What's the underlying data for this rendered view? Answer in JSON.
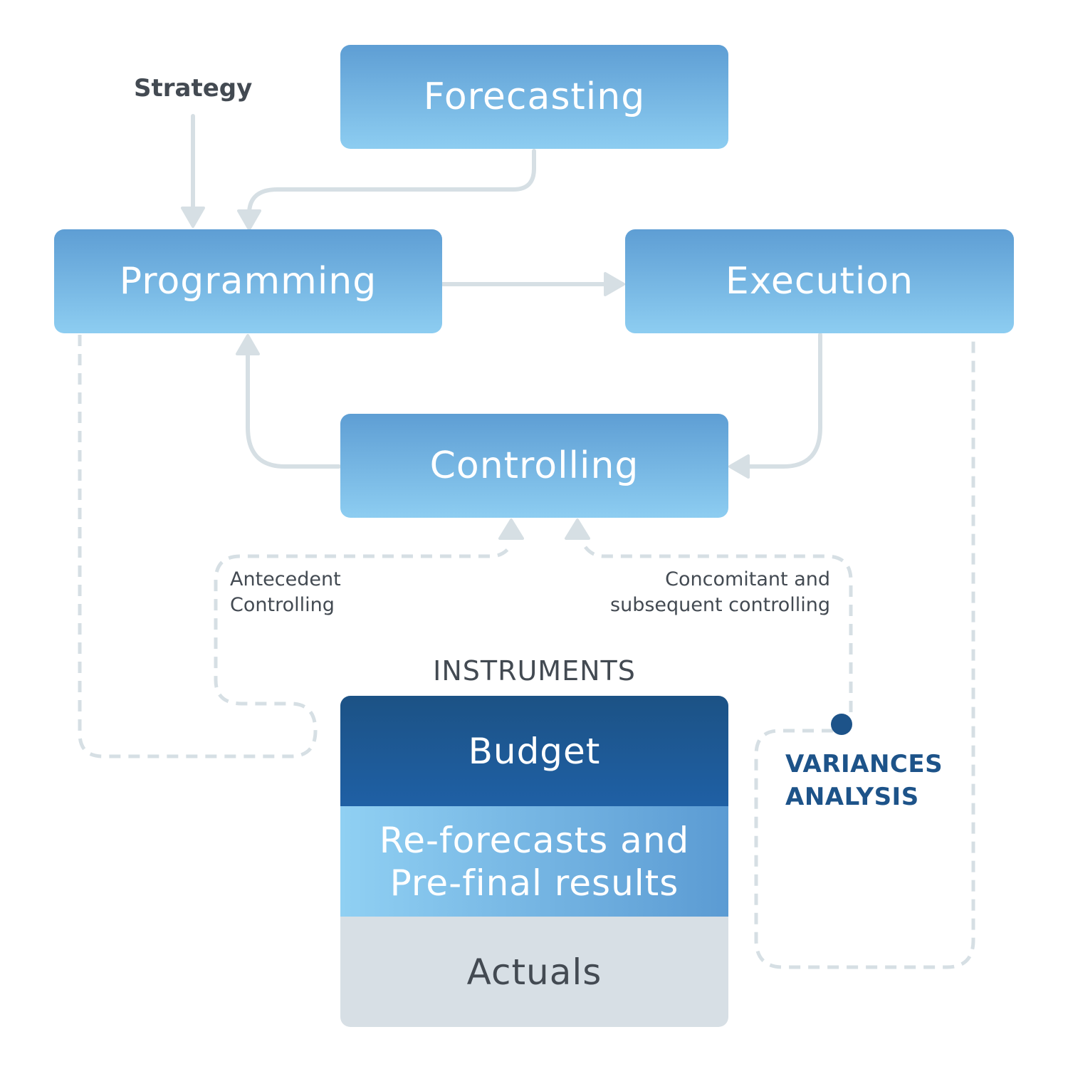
{
  "nodes": {
    "forecasting": "Forecasting",
    "programming": "Programming",
    "execution": "Execution",
    "controlling": "Controlling"
  },
  "labels": {
    "strategy": "Strategy",
    "antecedent": [
      "Antecedent",
      "Controlling"
    ],
    "concomitant": [
      "Concomitant and",
      "subsequent controlling"
    ],
    "instruments": "INSTRUMENTS",
    "variances": [
      "VARIANCES",
      "ANALYSIS"
    ]
  },
  "instruments": {
    "budget": "Budget",
    "reforecast": [
      "Re-forecasts and",
      "Pre-final results"
    ],
    "actuals": "Actuals"
  },
  "colors": {
    "box_gradient_top": "#5e9ed4",
    "box_gradient_bottom": "#8dcdf1",
    "budget": "#1f5a96",
    "actuals": "#d7dfe5",
    "connector": "#d6dfe4",
    "text_dark": "#434a52",
    "accent_dark_blue": "#1d5389"
  }
}
